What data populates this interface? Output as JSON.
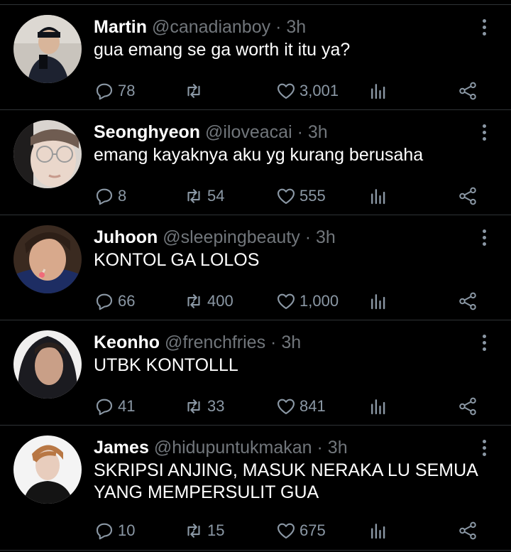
{
  "colors": {
    "background": "#000000",
    "divider": "#2f3336",
    "name": "#ffffff",
    "secondary": "#71767b",
    "icon": "#8b98a5"
  },
  "icons": {
    "reply": "reply-icon",
    "retweet": "retweet-icon",
    "like": "heart-icon",
    "stats": "views-stats-icon",
    "share": "share-icon",
    "more": "more-dots-icon"
  },
  "tweets": [
    {
      "name": "Martin",
      "handle": "@canadianboy",
      "sep": "·",
      "time": "3h",
      "text": "gua emang se ga worth it itu ya?",
      "replies": "78",
      "retweets": "",
      "likes": "3,001"
    },
    {
      "name": "Seonghyeon",
      "handle": "@iloveacai",
      "sep": "·",
      "time": "3h",
      "text": "emang kayaknya aku yg kurang berusaha",
      "replies": "8",
      "retweets": "54",
      "likes": "555"
    },
    {
      "name": "Juhoon",
      "handle": "@sleepingbeauty",
      "sep": "·",
      "time": "3h",
      "text": "KONTOL GA LOLOS",
      "replies": "66",
      "retweets": "400",
      "likes": "1,000"
    },
    {
      "name": "Keonho",
      "handle": "@frenchfries",
      "sep": "·",
      "time": "3h",
      "text": "UTBK KONTOLLL",
      "replies": "41",
      "retweets": "33",
      "likes": "841"
    },
    {
      "name": "James",
      "handle": "@hidupuntukmakan",
      "sep": "·",
      "time": "3h",
      "text": "SKRIPSI ANJING, MASUK NERAKA LU SEMUA YANG MEMPERSULIT GUA",
      "replies": "10",
      "retweets": "15",
      "likes": "675"
    }
  ]
}
